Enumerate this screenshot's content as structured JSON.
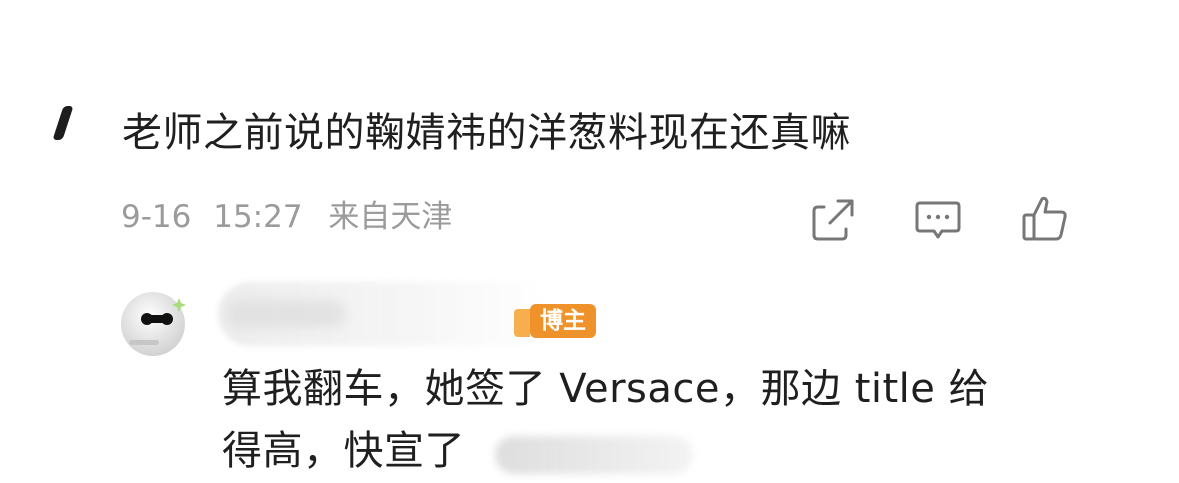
{
  "comment": {
    "text": "老师之前说的鞠婧祎的洋葱料现在还真嘛",
    "date": "9-16",
    "time": "15:27",
    "location": "来自天津"
  },
  "actions": {
    "share_icon": "share-icon",
    "comment_icon": "comment-icon",
    "like_icon": "thumbs-up-icon"
  },
  "reply": {
    "badge": "博主",
    "line1": "算我翻车，她签了 Versace，那边 title 给",
    "line2": "得高，快宣了"
  },
  "colors": {
    "badge": "#f0922a",
    "meta": "#9b9b9b",
    "text": "#1f1f1f"
  }
}
